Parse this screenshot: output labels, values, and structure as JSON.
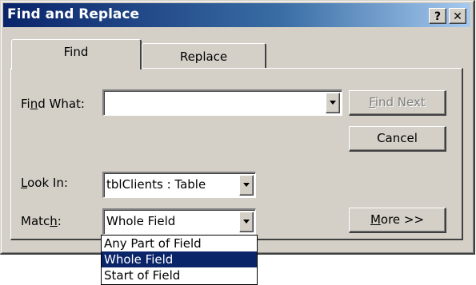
{
  "window": {
    "title": "Find and Replace",
    "help_label": "?",
    "close_label": "✕"
  },
  "tabs": [
    {
      "label": "Find",
      "active": true
    },
    {
      "label": "Replace",
      "active": false
    }
  ],
  "find_what": {
    "pre": "Fi",
    "key": "n",
    "post": "d What:",
    "value": ""
  },
  "look_in": {
    "key": "L",
    "post": "ook In:",
    "value": "tblClients : Table"
  },
  "match": {
    "pre": "Matc",
    "key": "h",
    "post": ":",
    "value": "Whole Field",
    "options": [
      "Any Part of Field",
      "Whole Field",
      "Start of Field"
    ]
  },
  "buttons": {
    "find_next": {
      "key": "F",
      "rest": "ind Next",
      "enabled": false
    },
    "cancel": "Cancel",
    "more": {
      "key": "M",
      "rest": "ore >>"
    }
  },
  "colors": {
    "face": "#d4d0c8",
    "title_active": "#0a246a",
    "selection": "#0a246a"
  }
}
